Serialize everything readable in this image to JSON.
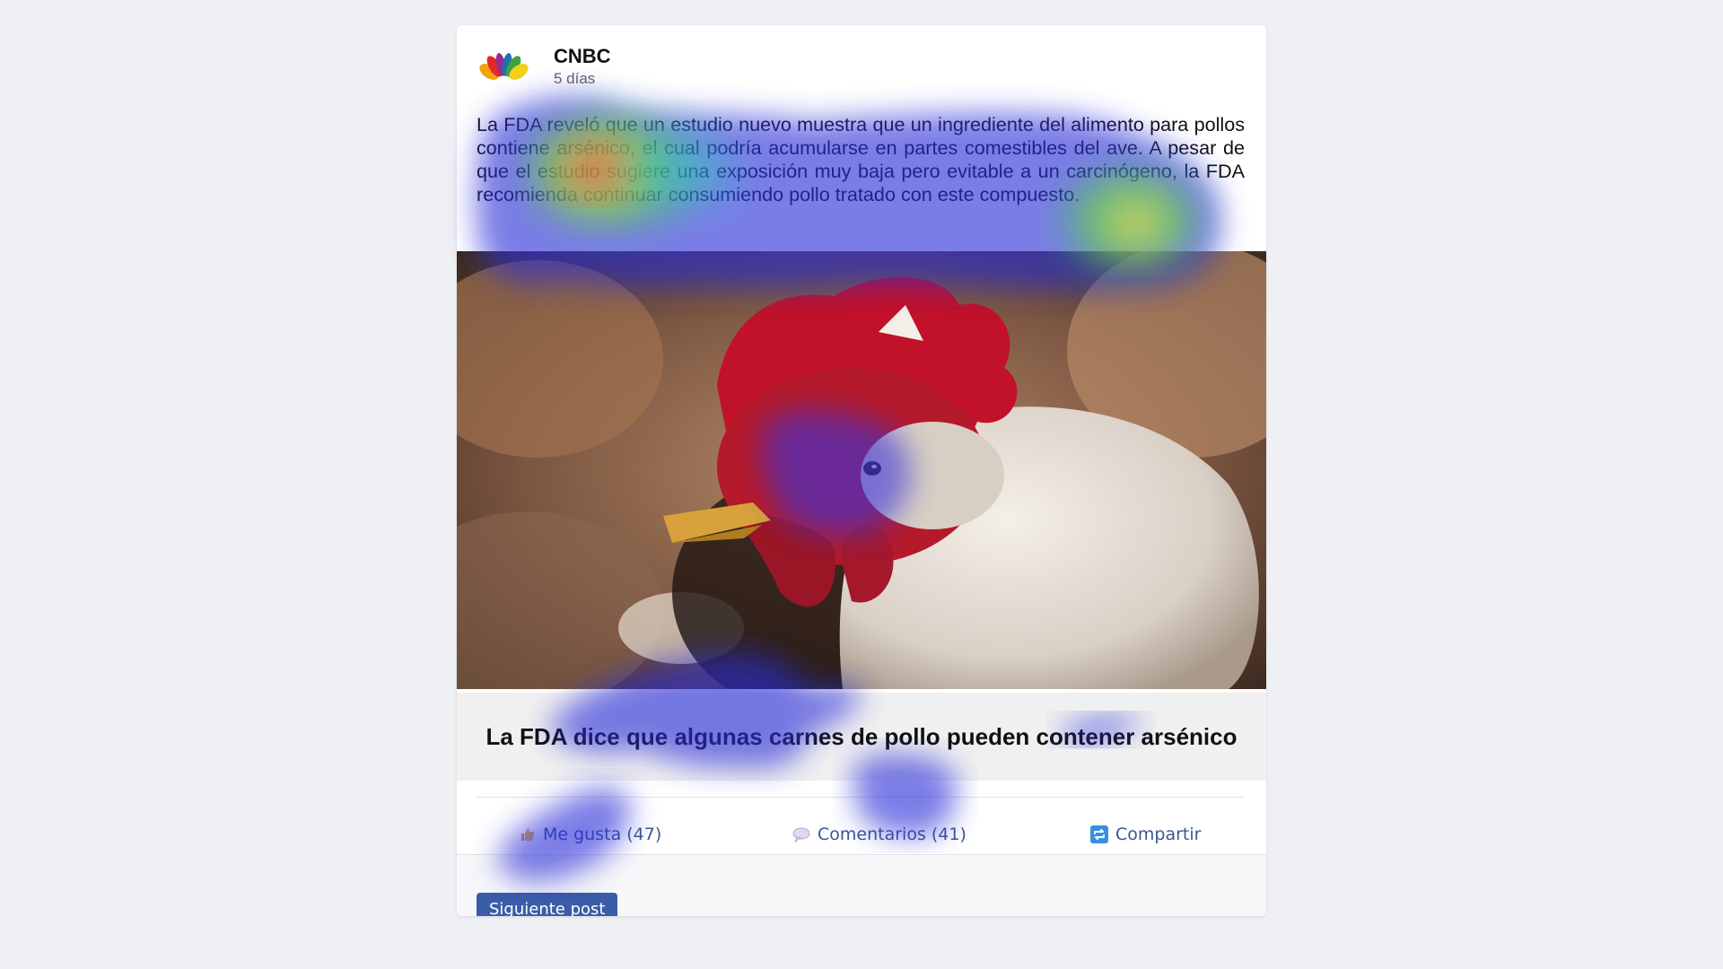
{
  "post": {
    "source": "CNBC",
    "time": "5 días",
    "text": "La FDA reveló que un estudio nuevo muestra que un ingrediente del alimento para pollos contiene arsénico, el cual podría acumularse en partes comestibles del ave. A pesar de que el estudio sugiere una exposición muy baja pero evitable a un carcinógeno, la FDA recomienda continuar consumiendo pollo tratado con este compuesto.",
    "link_title": "La FDA dice que algunas carnes de pollo pueden contener arsénico"
  },
  "actions": {
    "like": {
      "label": "Me gusta (47)",
      "icon": "thumbs-up-icon"
    },
    "comments": {
      "label": "Comentarios (41)",
      "icon": "speech-bubble-icon"
    },
    "share": {
      "label": "Compartir",
      "icon": "share-icon"
    }
  },
  "footer": {
    "next_label": "Siguiente post"
  },
  "colors": {
    "page_background": "#eff0f4",
    "action_text": "#3a5795",
    "next_button": "#3b5ca8",
    "link_preview_background": "#f0f0f0"
  }
}
